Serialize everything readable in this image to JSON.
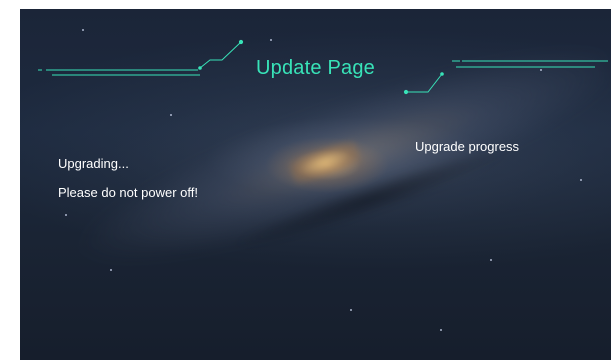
{
  "header": {
    "title": "Update Page",
    "title_color": "#38e3b8",
    "accent_line_color": "#38e3b8"
  },
  "status": {
    "line1": "Upgrading...",
    "line2": "Please do not power off!"
  },
  "progress": {
    "label": "Upgrade progress"
  },
  "background": {
    "theme": "galaxy",
    "base_color": "#1b2538"
  }
}
